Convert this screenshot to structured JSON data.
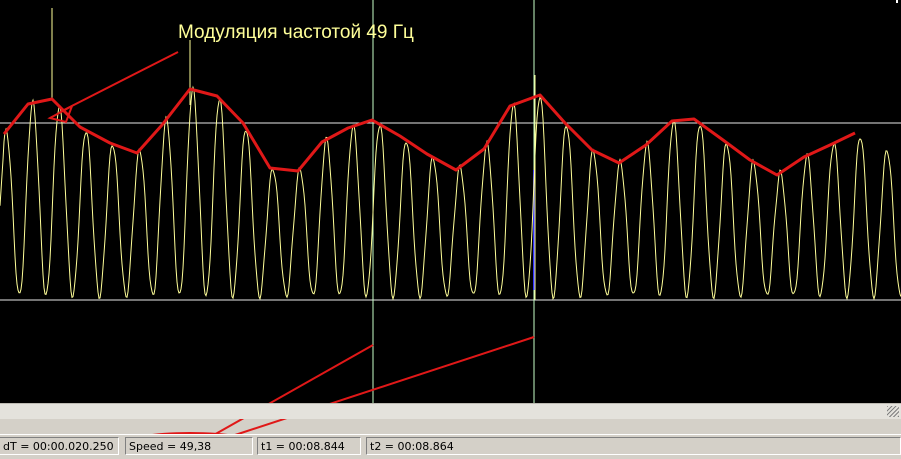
{
  "annotation": {
    "title": "Модуляция частотой 49 Гц"
  },
  "status": {
    "dt": "dT = 00:00.020.250",
    "speed": "Speed = 49,38",
    "t1": "t1 = 00:08.844",
    "t2": "t2 = 00:08.864"
  },
  "colors": {
    "background": "#000000",
    "signal": "#ffff99",
    "cursor": "#c8ffc8",
    "annotation": "#e01818",
    "statusbar": "#d4d0c8"
  }
}
